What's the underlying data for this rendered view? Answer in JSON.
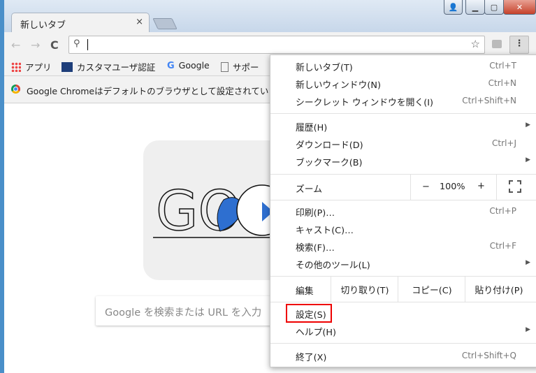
{
  "tab": {
    "title": "新しいタブ",
    "close": "×"
  },
  "toolbar": {
    "back": "←",
    "forward": "→",
    "reload": "C",
    "search_glyph": "⚲",
    "star": "☆",
    "menu": "⋮"
  },
  "bookmarks": [
    {
      "label": "アプリ"
    },
    {
      "label": "カスタマユーザ認証"
    },
    {
      "label": "Google"
    },
    {
      "label": "サポー"
    }
  ],
  "infobar": {
    "message": "Google Chromeはデフォルトのブラウザとして設定されていま"
  },
  "search": {
    "placeholder": "Google を検索または URL を入力"
  },
  "menu": {
    "new_tab": {
      "label": "新しいタブ(T)",
      "shortcut": "Ctrl+T"
    },
    "new_window": {
      "label": "新しいウィンドウ(N)",
      "shortcut": "Ctrl+N"
    },
    "incognito": {
      "label": "シークレット ウィンドウを開く(I)",
      "shortcut": "Ctrl+Shift+N"
    },
    "history": {
      "label": "履歴(H)"
    },
    "downloads": {
      "label": "ダウンロード(D)",
      "shortcut": "Ctrl+J"
    },
    "bookmarks": {
      "label": "ブックマーク(B)"
    },
    "zoom": {
      "label": "ズーム",
      "minus": "−",
      "value": "100%",
      "plus": "+"
    },
    "print": {
      "label": "印刷(P)…",
      "shortcut": "Ctrl+P"
    },
    "cast": {
      "label": "キャスト(C)…"
    },
    "find": {
      "label": "検索(F)…",
      "shortcut": "Ctrl+F"
    },
    "more_tools": {
      "label": "その他のツール(L)"
    },
    "edit": {
      "label": "編集",
      "cut": "切り取り(T)",
      "copy": "コピー(C)",
      "paste": "貼り付け(P)"
    },
    "settings": {
      "label": "設定(S)"
    },
    "help": {
      "label": "ヘルプ(H)"
    },
    "exit": {
      "label": "終了(X)",
      "shortcut": "Ctrl+Shift+Q"
    },
    "submenu_arrow": "▶"
  },
  "doodle": {
    "text": "GO"
  },
  "colors": {
    "highlight": "#e00000",
    "close": "#c6422b"
  }
}
